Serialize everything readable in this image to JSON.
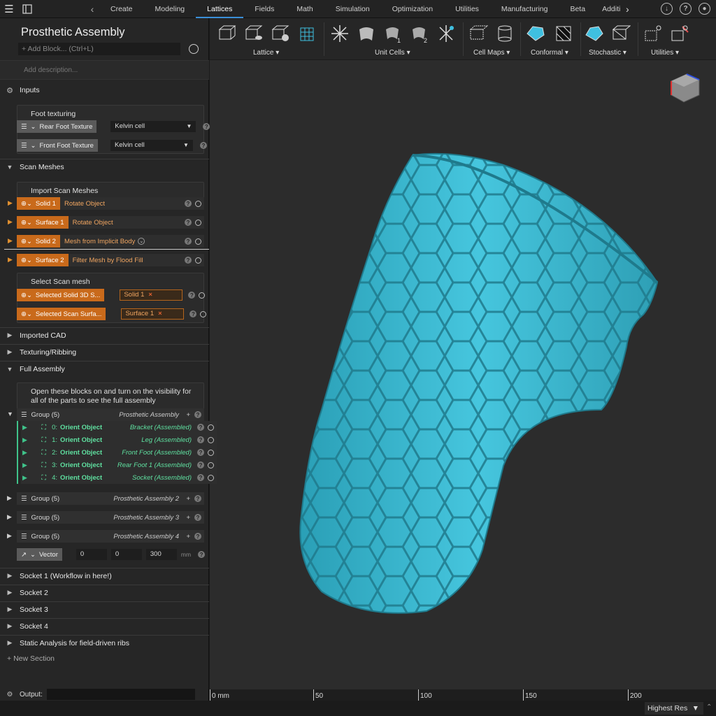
{
  "topbar": {
    "tabs": [
      "Create",
      "Modeling",
      "Lattices",
      "Fields",
      "Math",
      "Simulation",
      "Optimization",
      "Utilities",
      "Manufacturing",
      "Beta",
      "Additi"
    ],
    "active_tab": "Lattices"
  },
  "sidebar": {
    "title": "Prosthetic Assembly",
    "add_block_placeholder": "Add Block... (Ctrl+L)",
    "description_placeholder": "Add description...",
    "inputs_label": "Inputs",
    "foot_texturing_card": "Foot texturing",
    "rear_foot": {
      "label": "Rear Foot Texture",
      "value": "Kelvin cell"
    },
    "front_foot": {
      "label": "Front Foot Texture",
      "value": "Kelvin cell"
    },
    "scan_meshes_label": "Scan Meshes",
    "import_scan_card": "Import Scan Meshes",
    "scan_rows": [
      {
        "chip": "Solid 1",
        "op": "Rotate Object"
      },
      {
        "chip": "Surface 1",
        "op": "Rotate Object"
      },
      {
        "chip": "Solid 2",
        "op": "Mesh from Implicit Body"
      },
      {
        "chip": "Surface 2",
        "op": "Filter Mesh by Flood Fill"
      }
    ],
    "select_scan_card": "Select Scan mesh",
    "select_rows": [
      {
        "chip": "Selected Solid 3D S...",
        "tag": "Solid 1"
      },
      {
        "chip": "Selected Scan Surfa...",
        "tag": "Surface 1"
      }
    ],
    "imported_cad_label": "Imported CAD",
    "texturing_label": "Texturing/Ribbing",
    "full_assembly_label": "Full Assembly",
    "full_assembly_card": "Open these blocks on and turn on the visibility for all of the parts to see the full assembly",
    "group_main": {
      "label": "Group (5)",
      "name": "Prosthetic Assembly"
    },
    "orient_rows": [
      {
        "idx": "0:",
        "op": "Orient Object",
        "target": "Bracket (Assembled)"
      },
      {
        "idx": "1:",
        "op": "Orient Object",
        "target": "Leg (Assembled)"
      },
      {
        "idx": "2:",
        "op": "Orient Object",
        "target": "Front Foot (Assembled)"
      },
      {
        "idx": "3:",
        "op": "Orient Object",
        "target": "Rear Foot 1 (Assembled)"
      },
      {
        "idx": "4:",
        "op": "Orient Object",
        "target": "Socket (Assembled)"
      }
    ],
    "groups": [
      {
        "label": "Group (5)",
        "name": "Prosthetic Assembly 2"
      },
      {
        "label": "Group (5)",
        "name": "Prosthetic Assembly 3"
      },
      {
        "label": "Group (5)",
        "name": "Prosthetic Assembly 4"
      }
    ],
    "vector": {
      "label": "Vector",
      "x": "0",
      "y": "0",
      "z": "300",
      "unit": "mm"
    },
    "sections_bottom": [
      "Socket 1 (Workflow in here!)",
      "Socket 2",
      "Socket 3",
      "Socket 4",
      "Static Analysis for field-driven ribs"
    ],
    "new_section": "New Section",
    "output_label": "Output:"
  },
  "toolbar": {
    "groups": [
      "Lattice",
      "Unit Cells",
      "Cell Maps",
      "Conformal",
      "Stochastic",
      "Utilities"
    ]
  },
  "ruler": {
    "ticks": [
      "0 mm",
      "50",
      "100",
      "150",
      "200"
    ]
  },
  "status": {
    "resolution": "Highest Res"
  },
  "colors": {
    "accent": "#3b8fd8",
    "orange": "#c96a1b",
    "green": "#3fc38a",
    "mesh": "#3fb7cf"
  }
}
